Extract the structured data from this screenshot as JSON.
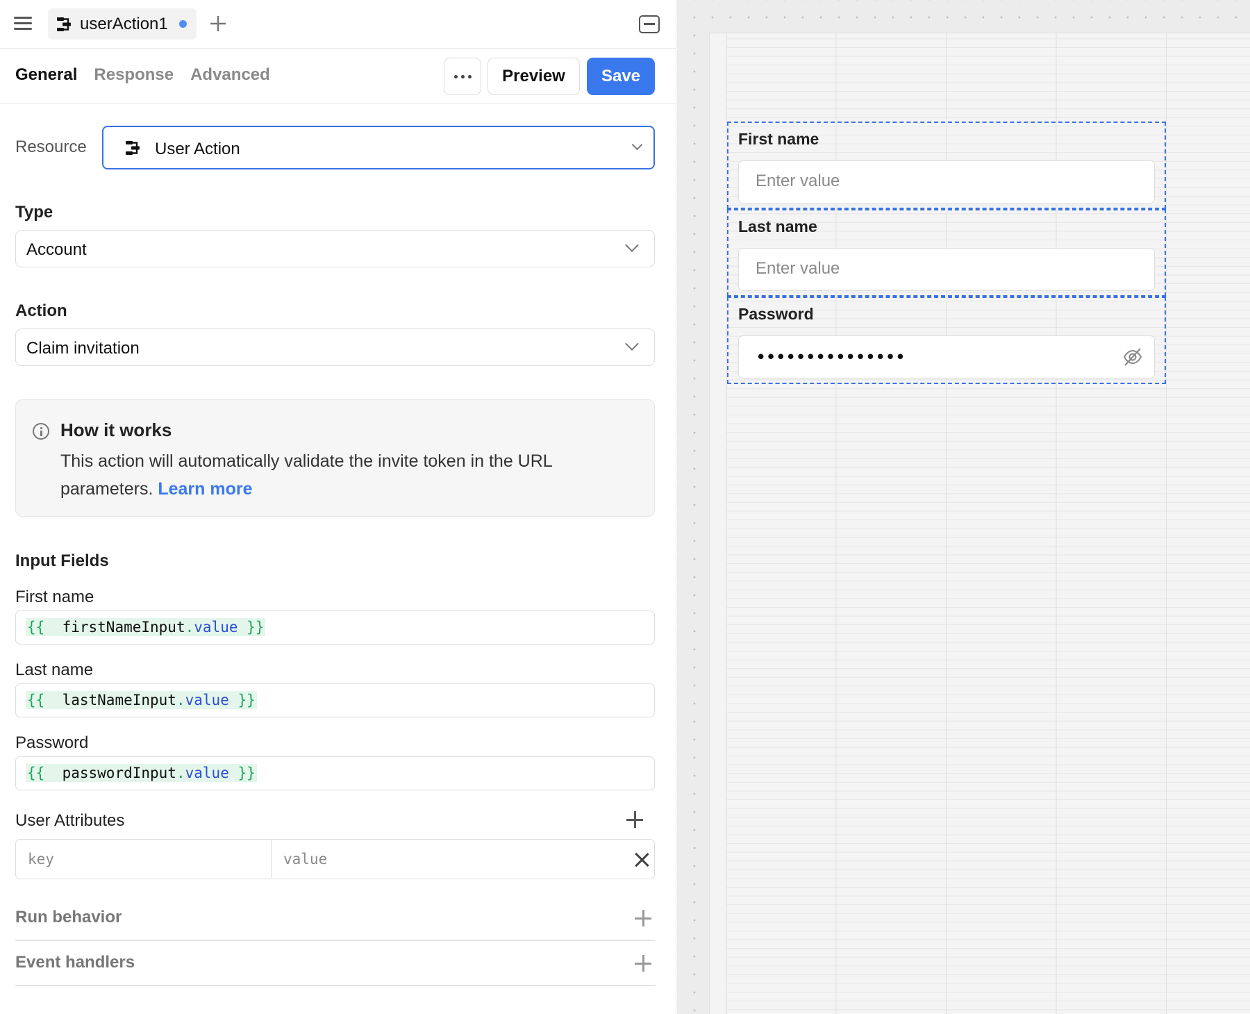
{
  "colors": {
    "accent": "#3b72e0",
    "save_bg": "#3a78ee",
    "dot": "#4f8ef7",
    "link": "#3a78ee"
  },
  "topbar": {
    "tab_label": "userAction1"
  },
  "subbar": {
    "tabs": [
      {
        "label": "General",
        "active": true
      },
      {
        "label": "Response",
        "active": false
      },
      {
        "label": "Advanced",
        "active": false
      }
    ],
    "preview_label": "Preview",
    "save_label": "Save"
  },
  "form": {
    "resource_label": "Resource",
    "resource_value": "User Action",
    "type_label": "Type",
    "type_value": "Account",
    "action_label": "Action",
    "action_value": "Claim invitation",
    "info": {
      "title": "How it works",
      "text": "This action will automatically validate the invite token in the URL parameters.",
      "link": "Learn more"
    },
    "input_fields_heading": "Input Fields",
    "fields": [
      {
        "label": "First name",
        "open": "{{",
        "ident": "firstNameInput",
        "dot": ".",
        "prop": "value",
        "close": "}}"
      },
      {
        "label": "Last name",
        "open": "{{",
        "ident": "lastNameInput",
        "dot": ".",
        "prop": "value",
        "close": "}}"
      },
      {
        "label": "Password",
        "open": "{{",
        "ident": "passwordInput",
        "dot": ".",
        "prop": "value",
        "close": "}}"
      }
    ],
    "user_attributes_label": "User Attributes",
    "kv_key_placeholder": "key",
    "kv_value_placeholder": "value",
    "run_behavior_label": "Run behavior",
    "event_handlers_label": "Event handlers"
  },
  "canvas": {
    "components": [
      {
        "label": "First name",
        "placeholder": "Enter value"
      },
      {
        "label": "Last name",
        "placeholder": "Enter value"
      },
      {
        "label": "Password",
        "masked_value": "•••••••••••••••"
      }
    ]
  }
}
